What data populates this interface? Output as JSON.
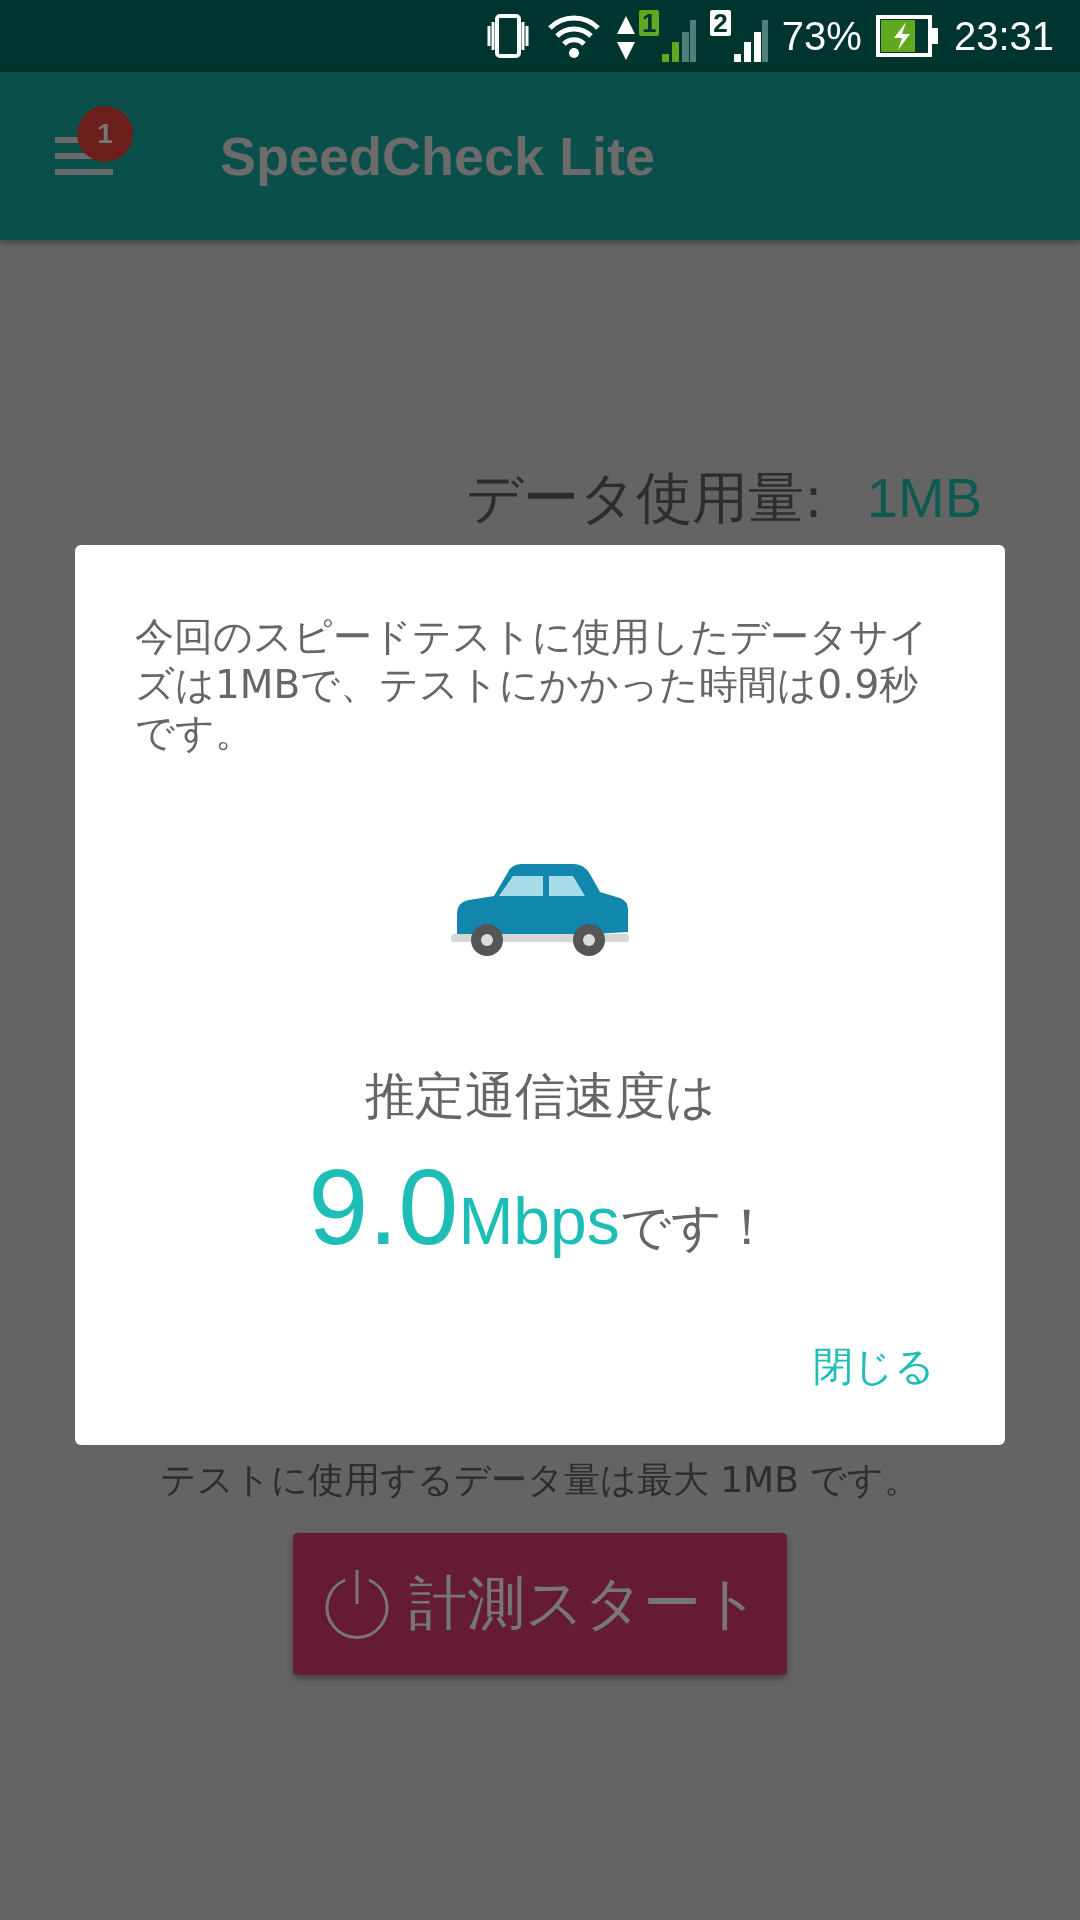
{
  "status_bar": {
    "sim_1": "1",
    "sim_2": "2",
    "battery": "73%",
    "time": "23:31"
  },
  "app_bar": {
    "badge": "1",
    "title": "SpeedCheck Lite"
  },
  "data_usage": {
    "label": "データ使用量:",
    "value": "1MB"
  },
  "note": "テストに使用するデータ量は最大 1MB です。",
  "start_button": "計測スタート",
  "dialog": {
    "message": "今回のスピードテストに使用したデータサイズは1MBで、テストにかかった時間は0.9秒です。",
    "headline": "推定通信速度は",
    "speed": "9.0",
    "unit": "Mbps",
    "suffix": "です！",
    "close": "閉じる"
  }
}
